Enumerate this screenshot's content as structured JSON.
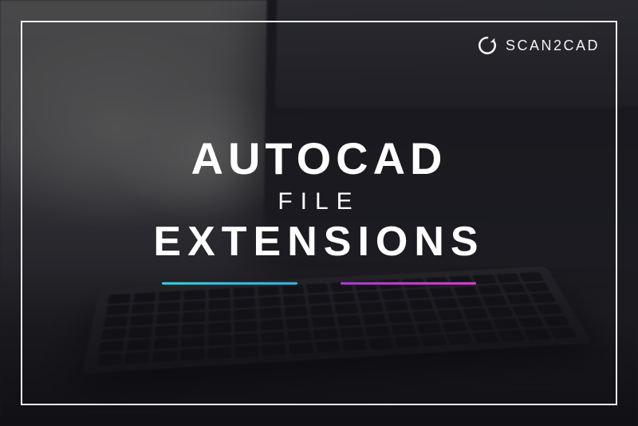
{
  "brand": {
    "name": "SCAN2CAD",
    "icon": "refresh-circle-icon"
  },
  "title": {
    "line1": "AUTOCAD",
    "line2": "FILE",
    "line3": "EXTENSIONS"
  },
  "accents": {
    "left_color": "#2fd6e3",
    "right_color": "#c73bd8"
  }
}
